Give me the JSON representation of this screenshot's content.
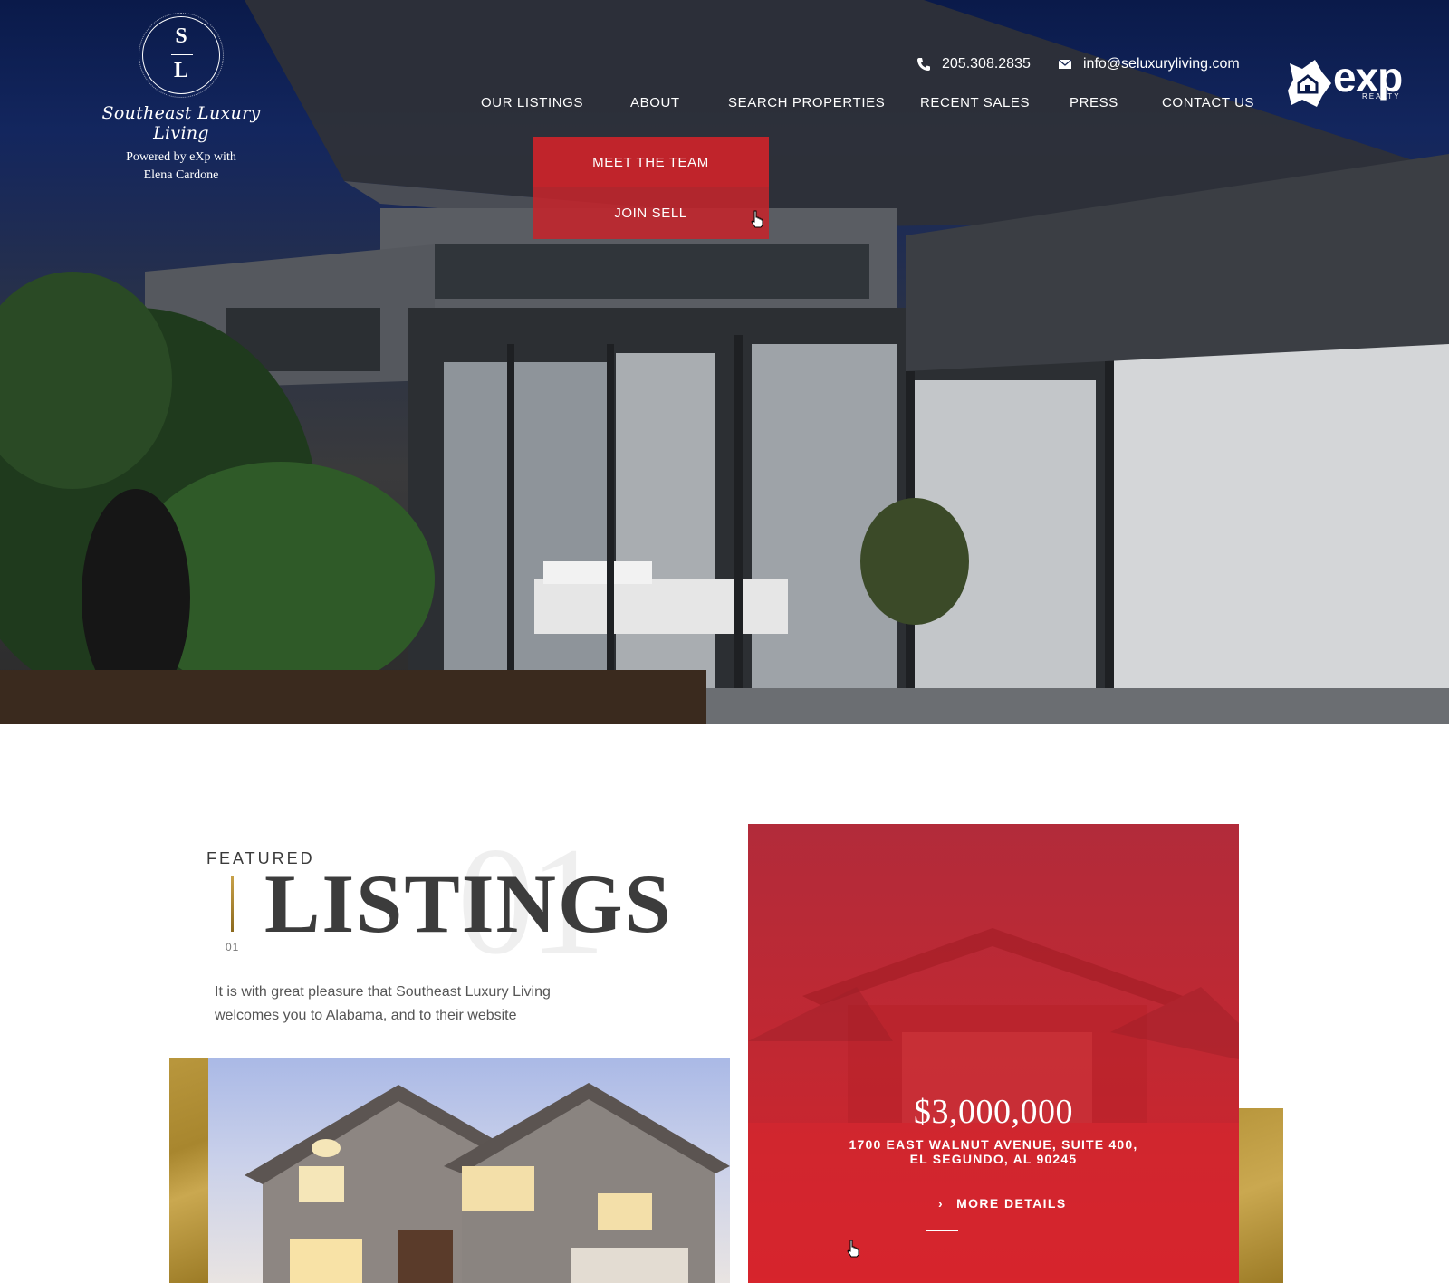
{
  "header": {
    "logo": {
      "monogram_top": "S",
      "monogram_bottom": "L",
      "script_name": "Southeast Luxury Living",
      "subtitle_line1": "Powered by eXp with",
      "subtitle_line2": "Elena Cardone"
    },
    "phone": "205.308.2835",
    "email": "info@seluxuryliving.com",
    "nav": [
      "OUR LISTINGS",
      "ABOUT",
      "SEARCH PROPERTIES",
      "RECENT SALES",
      "PRESS",
      "CONTACT US"
    ],
    "dropdown": [
      "MEET THE TEAM",
      "JOIN SELL"
    ],
    "partner_logo": {
      "main": "exp",
      "sub": "REALTY"
    }
  },
  "featured": {
    "label": "FEATURED",
    "title": "LISTINGS",
    "watermark_number": "01",
    "index": "01",
    "intro": "It is with great pleasure that Southeast Luxury Living welcomes you to Alabama, and to their website"
  },
  "listing": {
    "price": "$3,000,000",
    "address_line1": "1700 EAST WALNUT AVENUE, SUITE 400,",
    "address_line2": "EL SEGUNDO, AL 90245",
    "cta": "MORE DETAILS"
  },
  "colors": {
    "accent_red": "#c0242b",
    "gold": "#b9973d",
    "navy": "#0a1a4a"
  },
  "icons": [
    "phone-icon",
    "mail-icon",
    "chevron-right-icon",
    "hand-cursor-icon"
  ]
}
